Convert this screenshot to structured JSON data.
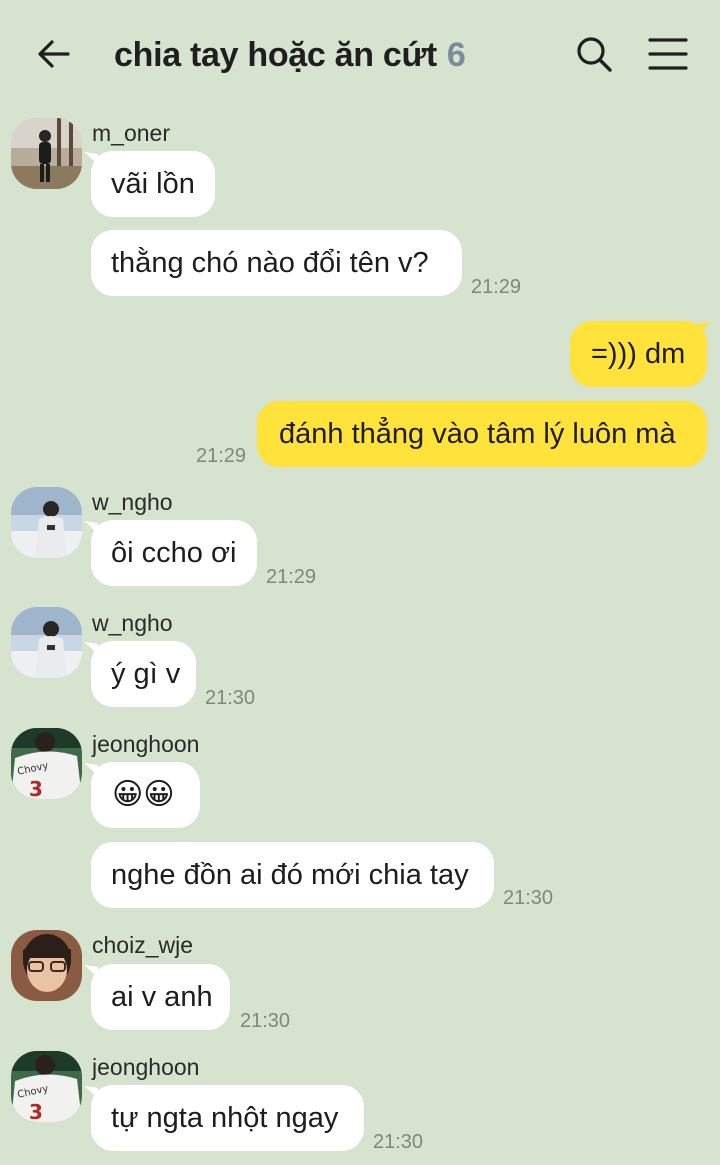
{
  "header": {
    "title": "chia tay hoặc ăn cứt",
    "member_count": "6",
    "back_icon": "arrow-left-icon",
    "search_icon": "search-icon",
    "menu_icon": "hamburger-menu-icon"
  },
  "messages": [
    {
      "sender": "m_oner",
      "text": "vãi lồn"
    },
    {
      "text": "thằng chó nào đổi tên v?",
      "time": "21:29"
    },
    {
      "text": "=))) dm"
    },
    {
      "text": "đánh thẳng vào tâm lý luôn mà",
      "time": "21:29"
    },
    {
      "sender": "w_ngho",
      "text": "ôi ccho ơi",
      "time": "21:29"
    },
    {
      "sender": "w_ngho",
      "text": "ý gì v",
      "time": "21:30"
    },
    {
      "sender": "jeonghoon",
      "text": "😀😀",
      "jersey": "Chovy",
      "jersey_number": "3"
    },
    {
      "text": "nghe đồn ai đó mới chia tay",
      "time": "21:30"
    },
    {
      "sender": "choiz_wje",
      "text": "ai v anh",
      "time": "21:30"
    },
    {
      "sender": "jeonghoon",
      "text": "tự ngta nhột ngay",
      "time": "21:30",
      "jersey": "Chovy",
      "jersey_number": "3"
    }
  ],
  "colors": {
    "background": "#d5e3cf",
    "incoming_bubble": "#ffffff",
    "outgoing_bubble": "#ffe23a",
    "timestamp": "#7c8a7a",
    "member_count": "#7d8a99"
  }
}
